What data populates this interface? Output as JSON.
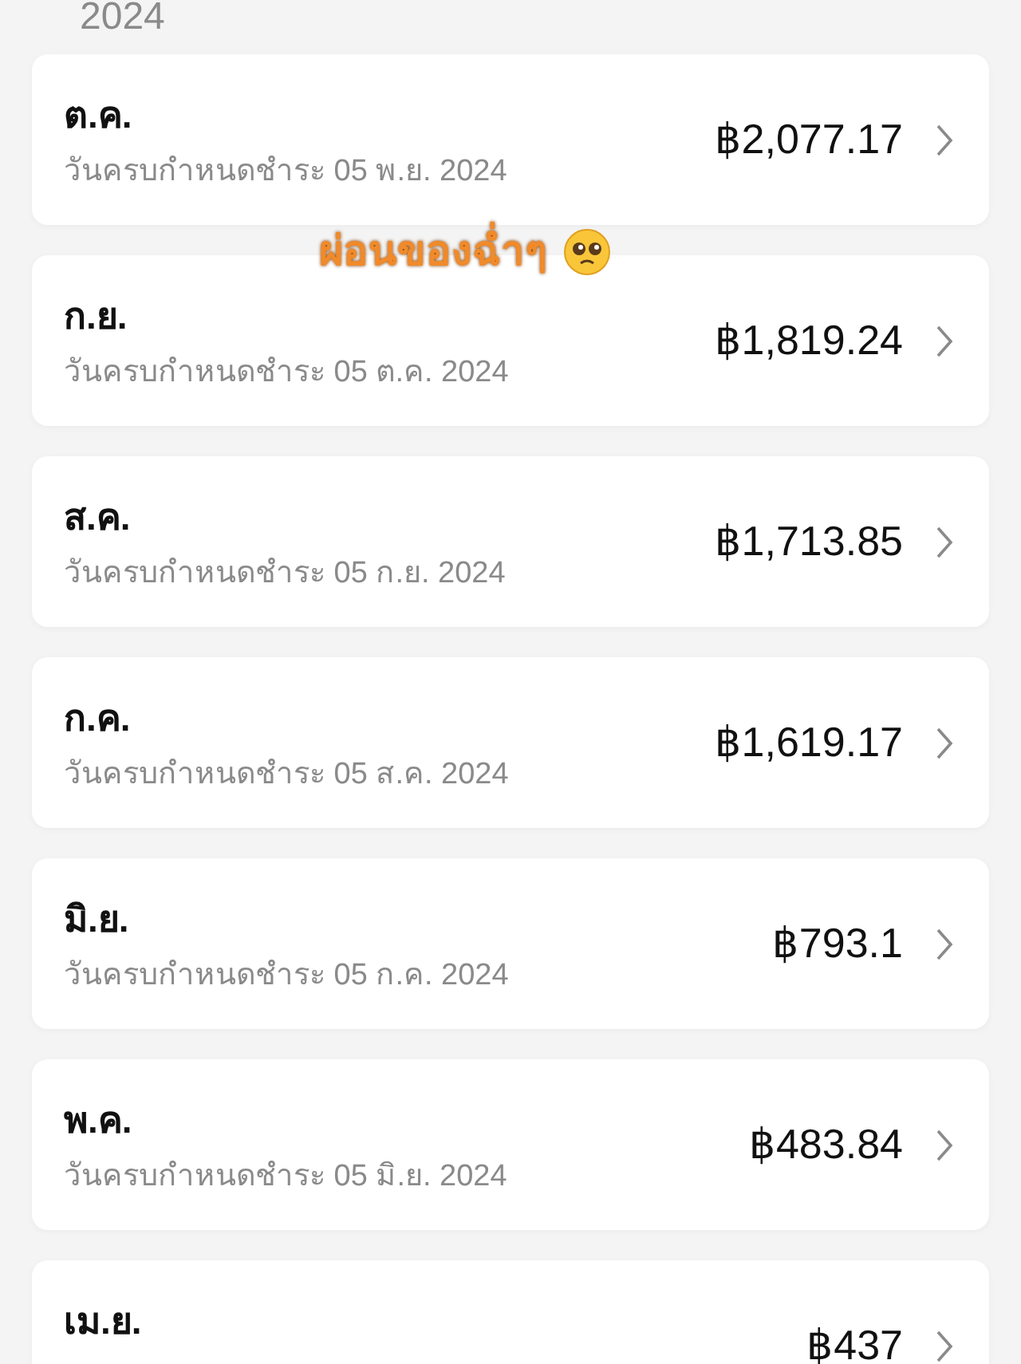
{
  "year_heading": "2024",
  "caption": {
    "text": "ผ่อนของฉ่ำๆ"
  },
  "installments": [
    {
      "month": "ต.ค.",
      "due": "วันครบกำหนดชำระ 05 พ.ย. 2024",
      "amount": "฿2,077.17"
    },
    {
      "month": "ก.ย.",
      "due": "วันครบกำหนดชำระ 05 ต.ค. 2024",
      "amount": "฿1,819.24"
    },
    {
      "month": "ส.ค.",
      "due": "วันครบกำหนดชำระ 05 ก.ย. 2024",
      "amount": "฿1,713.85"
    },
    {
      "month": "ก.ค.",
      "due": "วันครบกำหนดชำระ 05 ส.ค. 2024",
      "amount": "฿1,619.17"
    },
    {
      "month": "มิ.ย.",
      "due": "วันครบกำหนดชำระ 05 ก.ค. 2024",
      "amount": "฿793.1"
    },
    {
      "month": "พ.ค.",
      "due": "วันครบกำหนดชำระ 05 มิ.ย. 2024",
      "amount": "฿483.84"
    },
    {
      "month": "เม.ย.",
      "amount": "฿437"
    }
  ]
}
